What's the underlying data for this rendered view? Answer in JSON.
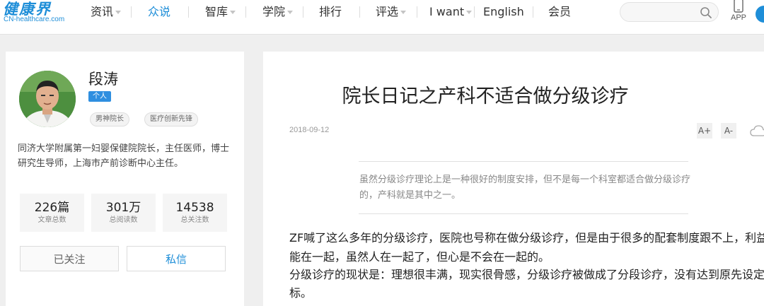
{
  "nav": {
    "logo_main": "健康界",
    "logo_sub": "CN-healthcare.com",
    "items": [
      {
        "label": "资讯"
      },
      {
        "label": "众说"
      },
      {
        "label": "智库"
      },
      {
        "label": "学院"
      },
      {
        "label": "排行"
      },
      {
        "label": "评选"
      },
      {
        "label": "I want"
      },
      {
        "label": "English"
      },
      {
        "label": "会员"
      }
    ],
    "search_placeholder": "",
    "app_label": "APP"
  },
  "profile": {
    "name": "段涛",
    "type_badge": "个人",
    "tags": [
      "男神院长",
      "医疗创新先锋"
    ],
    "bio": "同济大学附属第一妇婴保健院院长，主任医师，博士研究生导师，上海市产前诊断中心主任。",
    "stats": [
      {
        "value": "226篇",
        "label": "文章总数"
      },
      {
        "value": "301万",
        "label": "总阅读数"
      },
      {
        "value": "14538",
        "label": "总关注数"
      }
    ],
    "follow_button": "已关注",
    "message_button": "私信"
  },
  "article": {
    "title": "院长日记之产科不适合做分级诊疗",
    "date": "2018-09-12",
    "font_increase": "A+",
    "font_decrease": "A-",
    "summary_line1": "虽然分级诊疗理论上是一种很好的制度安排，但不是每一个科室都适合做分级诊疗",
    "summary_line2": "的，产科就是其中之一。",
    "paragraphs": [
      "ZF喊了这么多年的分级诊疗，医院也号称在做分级诊疗，但是由于很多的配套制度跟不上，利益",
      "能在一起，虽然人在一起了，但心是不会在一起的。",
      "分级诊疗的现状是：理想很丰满，现实很骨感，分级诊疗被做成了分段诊疗，没有达到原先设定",
      "标。"
    ]
  },
  "colors": {
    "accent": "#1e8ed8",
    "badge_blue": "#2f8fe0",
    "page_bg": "#efefef"
  },
  "icons": [
    "search-icon",
    "phone-icon",
    "cloud-icon"
  ]
}
